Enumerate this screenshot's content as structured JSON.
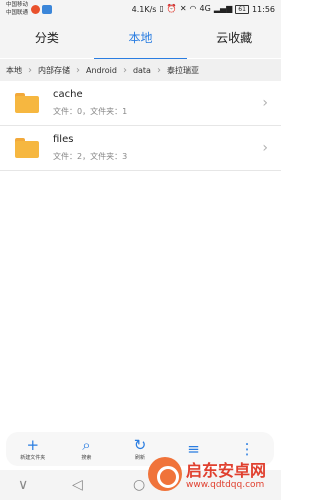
{
  "status": {
    "carrier1": "中国移动",
    "carrier2": "中国联通",
    "speed": "4.1K/s",
    "battery": "61",
    "time": "11:56",
    "network": "4G"
  },
  "tabs": [
    {
      "label": "分类",
      "active": false
    },
    {
      "label": "本地",
      "active": true
    },
    {
      "label": "云收藏",
      "active": false
    }
  ],
  "breadcrumb": [
    "本地",
    "内部存储",
    "Android",
    "data",
    "泰拉瑞亚"
  ],
  "files": [
    {
      "name": "cache",
      "meta": "文件：0，文件夹：1"
    },
    {
      "name": "files",
      "meta": "文件：2，文件夹：3"
    }
  ],
  "toolbar": [
    {
      "icon": "plus-icon",
      "label": "新建文件夹"
    },
    {
      "icon": "search-icon",
      "label": "搜索"
    },
    {
      "icon": "refresh-icon",
      "label": "刷新"
    },
    {
      "icon": "sort-icon",
      "label": ""
    },
    {
      "icon": "more-icon",
      "label": ""
    }
  ],
  "watermark": {
    "title": "启东安卓网",
    "url": "www.qdtdqq.com"
  },
  "colors": {
    "accent": "#2a7de1",
    "folder": "#f6b740"
  }
}
